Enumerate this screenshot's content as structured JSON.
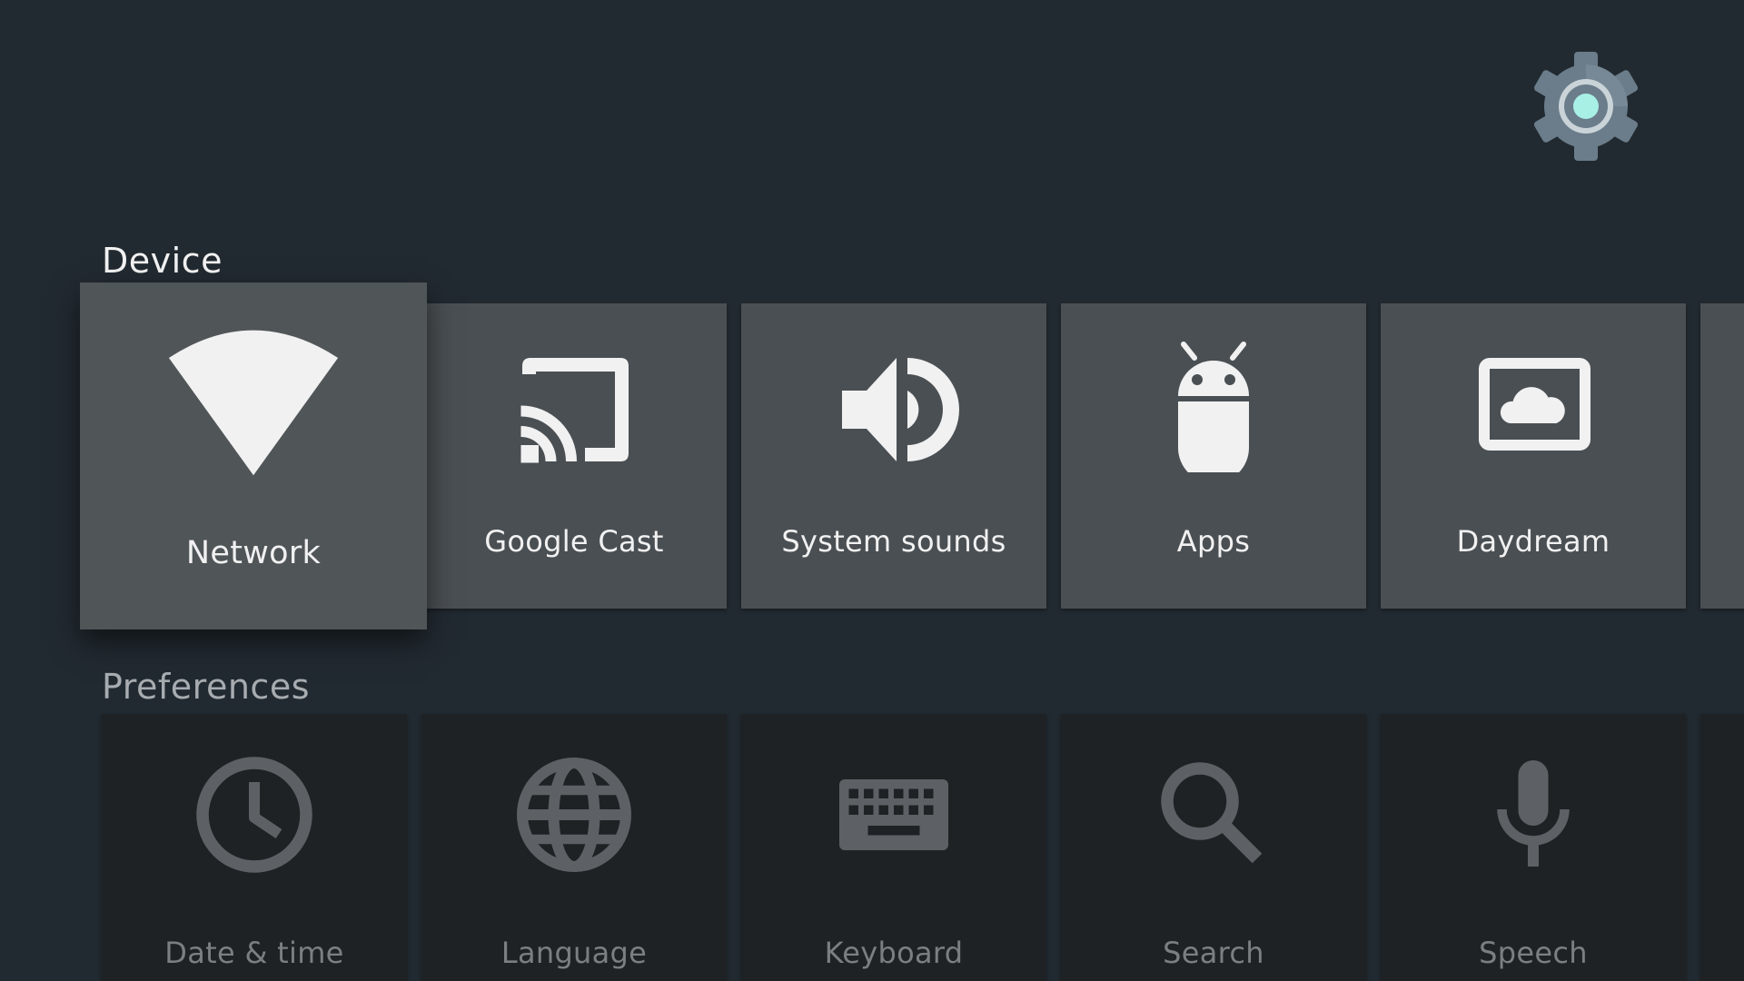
{
  "sections": {
    "device": {
      "title": "Device",
      "items": [
        {
          "label": "Network",
          "icon": "wifi-icon"
        },
        {
          "label": "Google Cast",
          "icon": "cast-icon"
        },
        {
          "label": "System sounds",
          "icon": "speaker-icon"
        },
        {
          "label": "Apps",
          "icon": "android-icon"
        },
        {
          "label": "Daydream",
          "icon": "daydream-icon"
        }
      ]
    },
    "preferences": {
      "title": "Preferences",
      "items": [
        {
          "label": "Date & time",
          "icon": "clock-icon"
        },
        {
          "label": "Language",
          "icon": "globe-icon"
        },
        {
          "label": "Keyboard",
          "icon": "keyboard-icon"
        },
        {
          "label": "Search",
          "icon": "search-icon"
        },
        {
          "label": "Speech",
          "icon": "microphone-icon"
        }
      ]
    }
  },
  "header": {
    "icon": "settings-gear-icon"
  },
  "colors": {
    "background": "#222a31",
    "device_tile": "#4a4f53",
    "pref_tile": "#1f2225",
    "gear_accent": "#a8f0e6",
    "gear_body": "#6b7d8a"
  }
}
